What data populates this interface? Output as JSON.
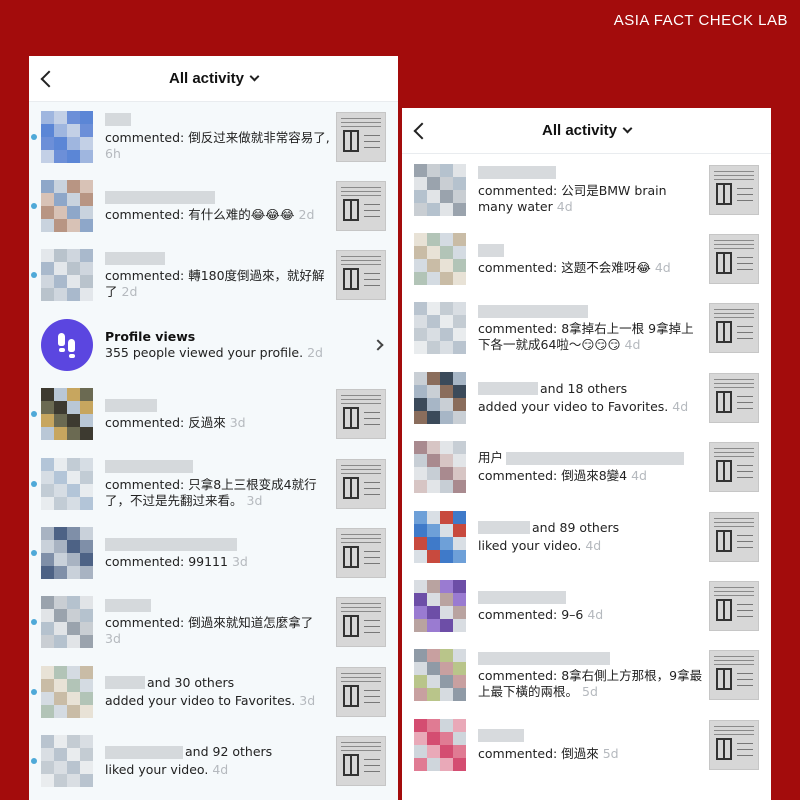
{
  "brand": "ASIA FACT CHECK LAB",
  "left_screen": {
    "header": {
      "title": "All activity",
      "back_icon": "chevron-left-icon",
      "dropdown_icon": "chevron-down-icon"
    },
    "items": [
      {
        "kind": "activity",
        "unread": true,
        "name_prefix": "",
        "name_suffix": "",
        "action": "commented: 倒反过来做就非常容易了,",
        "time": "6h",
        "time_newline": true
      },
      {
        "kind": "activity",
        "unread": true,
        "name_prefix": "",
        "name_suffix": "",
        "action": "commented: 有什么难的😂😂😂",
        "time": "2d"
      },
      {
        "kind": "activity",
        "unread": true,
        "name_prefix": "",
        "name_suffix": "",
        "action": "commented: 轉180度倒過來，就好解了",
        "time": "2d"
      },
      {
        "kind": "profile_views",
        "unread": false,
        "title": "Profile views",
        "text": "355 people viewed your profile.",
        "time": "2d",
        "icon": "footprints-icon"
      },
      {
        "kind": "activity",
        "unread": true,
        "name_prefix": "",
        "name_suffix": "",
        "action": "commented: 反過來",
        "time": "3d"
      },
      {
        "kind": "activity",
        "unread": true,
        "name_prefix": "",
        "name_suffix": "",
        "action": "commented: 只拿8上三根变成4就行了，不过是先翻过来看。",
        "time": "3d"
      },
      {
        "kind": "activity",
        "unread": true,
        "name_prefix": "",
        "name_suffix": "",
        "action": "commented: 99111",
        "time": "3d"
      },
      {
        "kind": "activity",
        "unread": true,
        "name_prefix": "",
        "name_suffix": "",
        "action": "commented: 倒過來就知道怎麼拿了",
        "time": "3d",
        "time_newline": true
      },
      {
        "kind": "activity",
        "unread": true,
        "name_prefix": "",
        "name_suffix": "and 30 others",
        "action": "added your video to Favorites.",
        "time": "3d"
      },
      {
        "kind": "activity",
        "unread": true,
        "name_prefix": "",
        "name_suffix": "and 92 others",
        "action": "liked your video.",
        "time": "4d"
      }
    ]
  },
  "right_screen": {
    "header": {
      "title": "All activity",
      "back_icon": "chevron-left-icon",
      "dropdown_icon": "chevron-down-icon"
    },
    "items": [
      {
        "kind": "activity",
        "unread": false,
        "name_prefix": "",
        "name_suffix": "",
        "action": "commented: 公司是BMW brain many water",
        "time": "4d"
      },
      {
        "kind": "activity",
        "unread": false,
        "name_prefix": "",
        "name_suffix": "",
        "action": "commented: 这题不会难呀😂",
        "time": "4d"
      },
      {
        "kind": "activity",
        "unread": false,
        "name_prefix": "",
        "name_suffix": "",
        "action": "commented: 8拿掉右上一根 9拿掉上下各一就成64啦～😏😏😏",
        "time": "4d"
      },
      {
        "kind": "activity",
        "unread": false,
        "name_prefix": "",
        "name_suffix": "and 18 others",
        "action": "added your video to Favorites.",
        "time": "4d"
      },
      {
        "kind": "activity",
        "unread": false,
        "name_prefix": "用户",
        "name_suffix": "",
        "action": "commented: 倒過來8變4",
        "time": "4d"
      },
      {
        "kind": "activity",
        "unread": false,
        "name_prefix": "",
        "name_suffix": "and 89 others",
        "action": "liked your video.",
        "time": "4d"
      },
      {
        "kind": "activity",
        "unread": false,
        "name_prefix": "",
        "name_suffix": "",
        "action": "commented: 9–6",
        "time": "4d"
      },
      {
        "kind": "activity",
        "unread": false,
        "name_prefix": "",
        "name_suffix": "",
        "action": "commented: 8拿右側上方那根，9拿最上最下橫的兩根。",
        "time": "5d"
      },
      {
        "kind": "activity",
        "unread": false,
        "name_prefix": "",
        "name_suffix": "",
        "action": "commented: 倒過來",
        "time": "5d"
      }
    ]
  },
  "colors": {
    "background": "#a30c0c",
    "unread_dot": "#4ea9d8",
    "profile_icon": "#5b46e0",
    "timestamp": "#b5b9be"
  }
}
